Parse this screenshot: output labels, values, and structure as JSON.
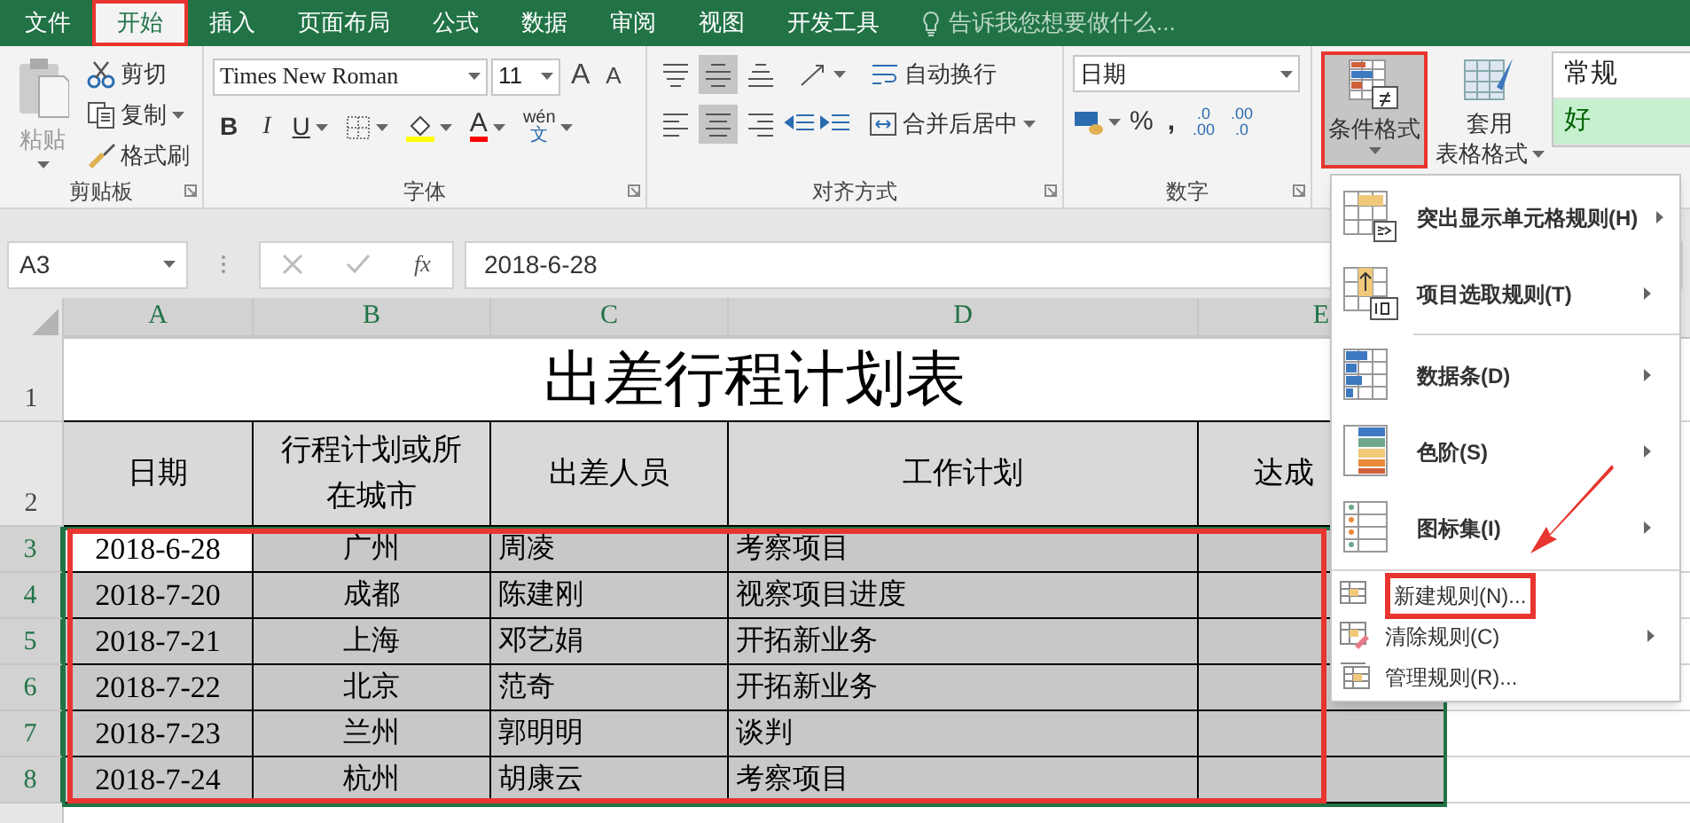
{
  "tabs": [
    {
      "label": "文件",
      "selected": false,
      "annotated": false
    },
    {
      "label": "开始",
      "selected": true,
      "annotated": true
    },
    {
      "label": "插入",
      "selected": false,
      "annotated": false
    },
    {
      "label": "页面布局",
      "selected": false,
      "annotated": false
    },
    {
      "label": "公式",
      "selected": false,
      "annotated": false
    },
    {
      "label": "数据",
      "selected": false,
      "annotated": false
    },
    {
      "label": "审阅",
      "selected": false,
      "annotated": false
    },
    {
      "label": "视图",
      "selected": false,
      "annotated": false
    },
    {
      "label": "开发工具",
      "selected": false,
      "annotated": false
    }
  ],
  "tell_me": {
    "placeholder": "告诉我您想要做什么..."
  },
  "clipboard": {
    "title": "剪贴板",
    "paste": "粘贴",
    "cut": "剪切",
    "copy": "复制",
    "format_painter": "格式刷"
  },
  "font": {
    "title": "字体",
    "name": "Times New Roman",
    "size": "11",
    "grow": "A",
    "shrink": "A",
    "bold": "B",
    "italic": "I",
    "underline": "U",
    "color_glyph": "A",
    "phonetic_top": "wén",
    "phonetic_bottom": "文"
  },
  "alignment": {
    "title": "对齐方式",
    "wrap_text": "自动换行",
    "merge_center": "合并后居中",
    "vertical": [
      {
        "kind": "top",
        "selected": false
      },
      {
        "kind": "middle",
        "selected": true
      },
      {
        "kind": "bottom",
        "selected": false
      }
    ],
    "horizontal": [
      {
        "kind": "left",
        "selected": false
      },
      {
        "kind": "center",
        "selected": true
      },
      {
        "kind": "right",
        "selected": false
      }
    ]
  },
  "number": {
    "title": "数字",
    "format": "日期",
    "percent": "%",
    "comma": ",",
    "increase_decimal": {
      "top": ".0",
      "bottom": ".00"
    },
    "decrease_decimal": {
      "top": ".00",
      "bottom": ".0"
    }
  },
  "styles": {
    "conditional_formatting": {
      "label": "条件格式",
      "selected": true,
      "annotated": true
    },
    "format_as_table": {
      "line1": "套用",
      "line2": "表格格式"
    },
    "cell_styles": [
      {
        "label": "常规",
        "kind": "normal"
      },
      {
        "label": "好",
        "kind": "good"
      }
    ]
  },
  "name_box": "A3",
  "function_label": "fx",
  "formula": "2018-6-28",
  "columns": [
    {
      "label": "A",
      "selected": true
    },
    {
      "label": "B",
      "selected": true
    },
    {
      "label": "C",
      "selected": true
    },
    {
      "label": "D",
      "selected": true
    },
    {
      "label": "E",
      "selected": true
    }
  ],
  "sheet": {
    "title_row": "1",
    "title": "出差行程计划表",
    "header_row": "2",
    "headers": [
      "日期",
      "行程计划或所在城市",
      "出差人员",
      "工作计划",
      "达成"
    ],
    "range_annotated": true,
    "rows": [
      {
        "number": "3",
        "selected": true,
        "date_active": true,
        "cells": [
          "2018-6-28",
          "广州",
          "周凌",
          "考察项目"
        ]
      },
      {
        "number": "4",
        "selected": true,
        "date_active": false,
        "cells": [
          "2018-7-20",
          "成都",
          "陈建刚",
          "视察项目进度"
        ]
      },
      {
        "number": "5",
        "selected": true,
        "date_active": false,
        "cells": [
          "2018-7-21",
          "上海",
          "邓艺娟",
          "开拓新业务"
        ]
      },
      {
        "number": "6",
        "selected": true,
        "date_active": false,
        "cells": [
          "2018-7-22",
          "北京",
          "范奇",
          "开拓新业务"
        ]
      },
      {
        "number": "7",
        "selected": true,
        "date_active": false,
        "cells": [
          "2018-7-23",
          "兰州",
          "郭明明",
          "谈判"
        ]
      },
      {
        "number": "8",
        "selected": true,
        "date_active": false,
        "cells": [
          "2018-7-24",
          "杭州",
          "胡康云",
          "考察项目"
        ]
      }
    ]
  },
  "menu": {
    "pointer_arrow": true,
    "items": [
      {
        "label": "突出显示单元格规则(H)",
        "kind": "highlight",
        "submenu": true,
        "annotated": false
      },
      {
        "label": "项目选取规则(T)",
        "kind": "top10",
        "submenu": true,
        "annotated": false
      },
      {
        "label": "数据条(D)",
        "kind": "databar",
        "submenu": true,
        "annotated": false
      },
      {
        "label": "色阶(S)",
        "kind": "colorscale",
        "submenu": true,
        "annotated": false
      },
      {
        "label": "图标集(I)",
        "kind": "iconset",
        "submenu": true,
        "annotated": false
      },
      {
        "label": "新建规则(N)...",
        "kind": "new",
        "submenu": false,
        "annotated": true
      },
      {
        "label": "清除规则(C)",
        "kind": "clear",
        "submenu": true,
        "annotated": false
      },
      {
        "label": "管理规则(R)...",
        "kind": "manage",
        "submenu": false,
        "annotated": false
      }
    ]
  }
}
